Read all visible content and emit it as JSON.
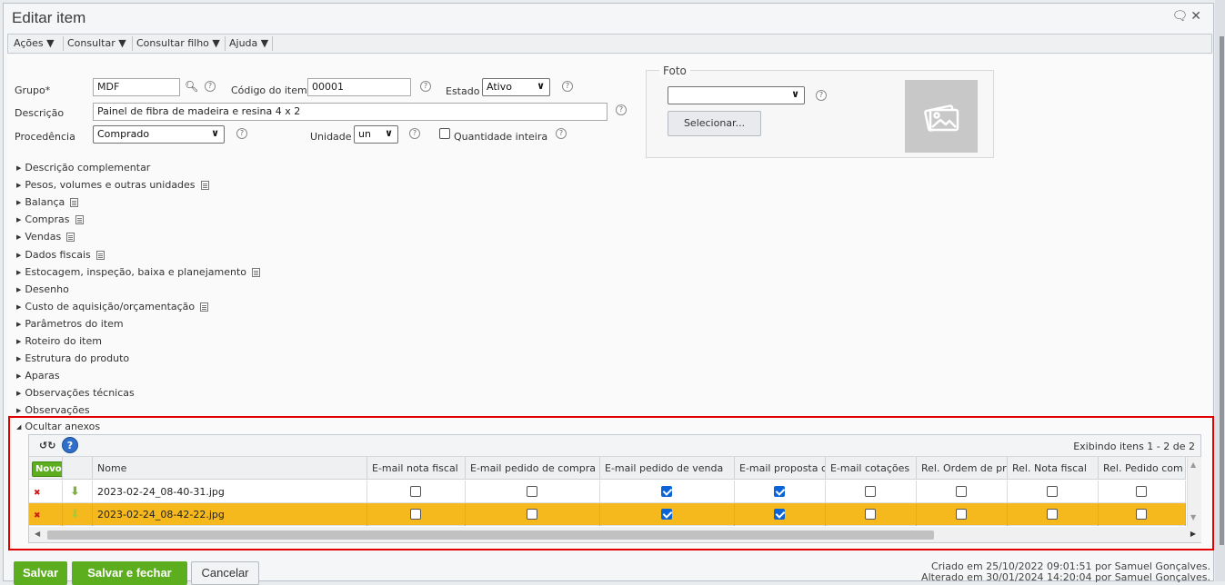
{
  "window": {
    "title": "Editar item"
  },
  "menu": [
    "Ações",
    "Consultar",
    "Consultar filho",
    "Ajuda"
  ],
  "form": {
    "grupo_label": "Grupo*",
    "grupo_value": "MDF",
    "codigo_label": "Código do item",
    "codigo_value": "00001",
    "estado_label": "Estado",
    "estado_value": "Ativo",
    "descricao_label": "Descrição",
    "descricao_value": "Painel de fibra de madeira e resina 4 x 2",
    "procedencia_label": "Procedência",
    "procedencia_value": "Comprado",
    "unidade_label": "Unidade",
    "unidade_value": "un",
    "quantidade_label": "Quantidade inteira",
    "quantidade_checked": false,
    "help_glyph": "?"
  },
  "foto": {
    "legend": "Foto",
    "select_value": "",
    "button_label": "Selecionar..."
  },
  "sections": [
    {
      "label": "Descrição complementar",
      "doc": false
    },
    {
      "label": "Pesos, volumes e outras unidades",
      "doc": true
    },
    {
      "label": "Balança",
      "doc": true
    },
    {
      "label": "Compras",
      "doc": true
    },
    {
      "label": "Vendas",
      "doc": true
    },
    {
      "label": "Dados fiscais",
      "doc": true
    },
    {
      "label": "Estocagem, inspeção, baixa e planejamento",
      "doc": true
    },
    {
      "label": "Desenho",
      "doc": false
    },
    {
      "label": "Custo de aquisição/orçamentação",
      "doc": true
    },
    {
      "label": "Parâmetros do item",
      "doc": false
    },
    {
      "label": "Roteiro do item",
      "doc": false
    },
    {
      "label": "Estrutura do produto",
      "doc": false
    },
    {
      "label": "Aparas",
      "doc": false
    },
    {
      "label": "Observações técnicas",
      "doc": false
    },
    {
      "label": "Observações",
      "doc": false
    }
  ],
  "anexos": {
    "toggle_label": "Ocultar anexos",
    "paging": "Exibindo itens 1 - 2 de 2",
    "novo_label": "Novo",
    "columns": [
      "Nome",
      "E-mail nota fiscal",
      "E-mail pedido de compra",
      "E-mail pedido de venda",
      "E-mail proposta c",
      "E-mail cotações",
      "Rel. Ordem de pr",
      "Rel. Nota fiscal",
      "Rel. Pedido com"
    ],
    "rows": [
      {
        "nome": "2023-02-24_08-40-31.jpg",
        "checks": [
          false,
          false,
          true,
          true,
          false,
          false,
          false,
          false
        ],
        "selected": false
      },
      {
        "nome": "2023-02-24_08-42-22.jpg",
        "checks": [
          false,
          false,
          true,
          true,
          false,
          false,
          false,
          false
        ],
        "selected": true
      }
    ]
  },
  "footer": {
    "salvar": "Salvar",
    "salvar_fechar": "Salvar e fechar",
    "cancelar": "Cancelar",
    "criado": "Criado em 25/10/2022 09:01:51 por Samuel Gonçalves.",
    "alterado": "Alterado em 30/01/2024 14:20:04 por Samuel Gonçalves."
  },
  "colors": {
    "accent_green": "#5cae1f",
    "selected_row": "#f5b91d",
    "highlight_red": "#e00000",
    "check_blue": "#0a64d8"
  }
}
